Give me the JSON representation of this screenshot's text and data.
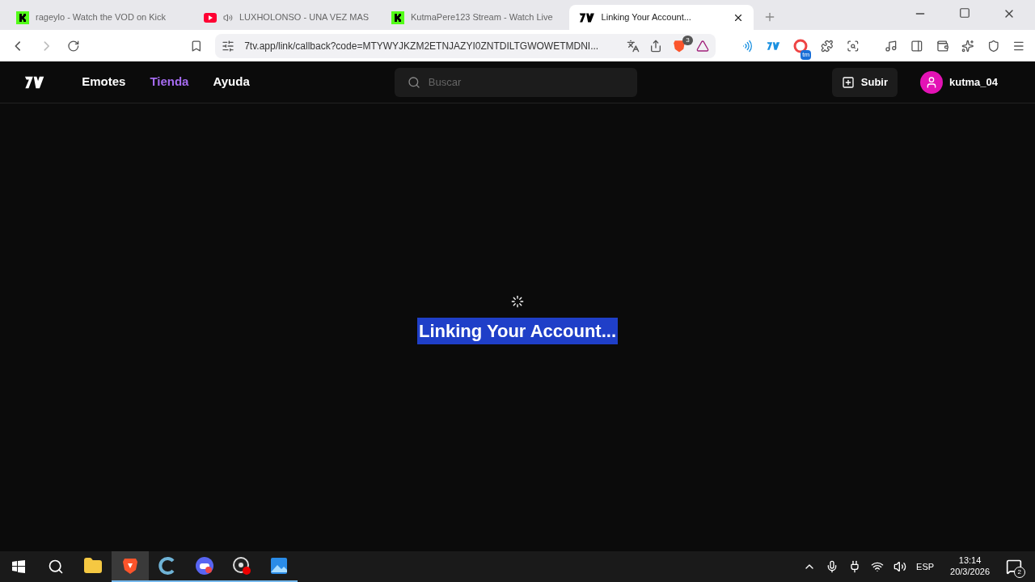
{
  "browser_tabs": [
    {
      "title": "rageylo - Watch the VOD on Kick",
      "kind": "kick",
      "audio": false,
      "selected": false
    },
    {
      "title": "LUXHOLONSO - UNA VEZ MAS",
      "kind": "youtube",
      "audio": true,
      "selected": false
    },
    {
      "title": "KutmaPere123 Stream - Watch Live",
      "kind": "kick",
      "audio": false,
      "selected": false
    },
    {
      "title": "Linking Your Account...",
      "kind": "seven",
      "audio": false,
      "selected": true
    }
  ],
  "address_bar": {
    "url": "7tv.app/link/callback?code=MTYWYJKZM2ETNJAZYI0ZNTDILTGWOWETMDNI...",
    "shields_count": "3"
  },
  "extension_badge": "tm",
  "site_nav": {
    "links": [
      {
        "label": "Emotes",
        "selected": false
      },
      {
        "label": "Tienda",
        "selected": true
      },
      {
        "label": "Ayuda",
        "selected": false
      }
    ],
    "search": {
      "placeholder": "Buscar"
    },
    "upload_button": "Subir",
    "username": "kutma_04"
  },
  "status": {
    "heading": "Linking Your Account...",
    "loading": true
  },
  "taskbar": {
    "apps": [
      {
        "kind": "files",
        "active": false,
        "running": false
      },
      {
        "kind": "brave",
        "active": true,
        "running": true
      },
      {
        "kind": "ccleaner",
        "active": false,
        "running": true
      },
      {
        "kind": "discord",
        "active": false,
        "running": true
      },
      {
        "kind": "obs",
        "active": false,
        "running": true
      },
      {
        "kind": "photos",
        "active": false,
        "running": true
      }
    ],
    "language": "ESP",
    "time": "13:14",
    "date": "20/3/2026",
    "notifications": "2"
  }
}
